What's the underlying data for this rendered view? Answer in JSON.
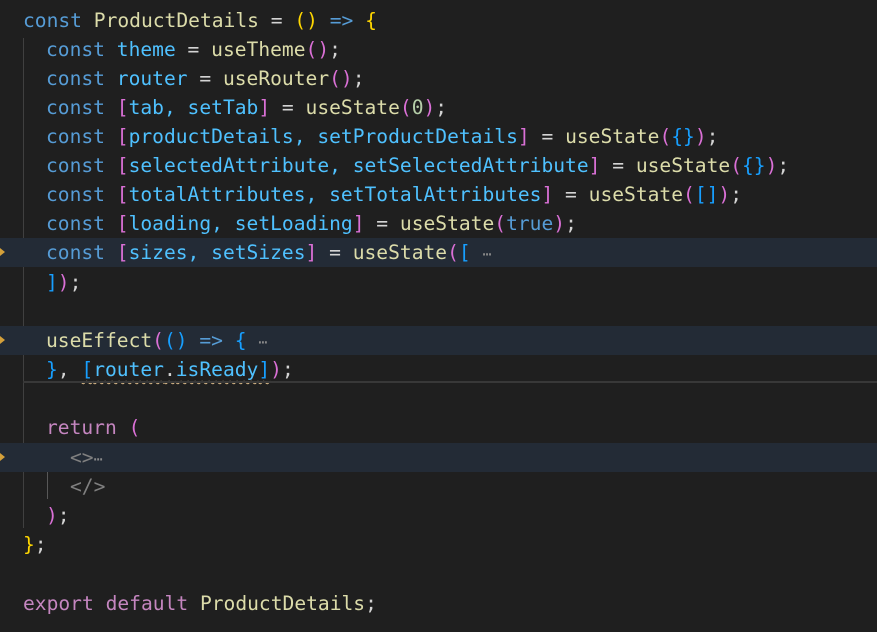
{
  "editor": {
    "theme_colors": {
      "background": "#1f1f1f",
      "keyword": "#569cd6",
      "variable": "#4fc1ff",
      "function": "#dcdcaa",
      "control": "#c586c0",
      "bracket_level1": "#ffd700",
      "bracket_level2": "#da70d6",
      "bracket_level3": "#179fff",
      "warning_squiggle": "#e2c08d"
    },
    "lines": [
      {
        "tokens": [
          "const",
          " ",
          "ProductDetails",
          " = ",
          "(",
          ")",
          " ",
          "=>",
          " ",
          "{"
        ]
      },
      {
        "tokens": [
          "const",
          " ",
          "theme",
          " = ",
          "useTheme",
          "(",
          ")",
          ";"
        ]
      },
      {
        "tokens": [
          "const",
          " ",
          "router",
          " = ",
          "useRouter",
          "(",
          ")",
          ";"
        ]
      },
      {
        "tokens": [
          "const",
          " ",
          "[",
          "tab, setTab",
          "]",
          " = ",
          "useState",
          "(",
          "0",
          ")",
          ";"
        ]
      },
      {
        "tokens": [
          "const",
          " ",
          "[",
          "productDetails, setProductDetails",
          "]",
          " = ",
          "useState",
          "(",
          "{}",
          ")",
          ";"
        ]
      },
      {
        "tokens": [
          "const",
          " ",
          "[",
          "selectedAttribute, setSelectedAttribute",
          "]",
          " = ",
          "useState",
          "(",
          "{}",
          ")",
          ";"
        ]
      },
      {
        "tokens": [
          "const",
          " ",
          "[",
          "totalAttributes, setTotalAttributes",
          "]",
          " = ",
          "useState",
          "(",
          "[]",
          ")",
          ";"
        ]
      },
      {
        "tokens": [
          "const",
          " ",
          "[",
          "loading, setLoading",
          "]",
          " = ",
          "useState",
          "(",
          "true",
          ")",
          ";"
        ]
      },
      {
        "tokens": [
          "const",
          " ",
          "[",
          "sizes, setSizes",
          "]",
          " = ",
          "useState",
          "(",
          "[",
          " ",
          "⋯"
        ]
      },
      {
        "tokens": [
          "]",
          ")",
          ";"
        ]
      },
      {
        "tokens": []
      },
      {
        "tokens": [
          "useEffect",
          "(",
          "(",
          ")",
          " ",
          "=>",
          " ",
          "{",
          " ",
          "⋯"
        ]
      },
      {
        "tokens": [
          "}",
          ", ",
          "[",
          "router",
          ".",
          "isReady",
          "]",
          ")",
          ";"
        ]
      },
      {
        "tokens": []
      },
      {
        "tokens": [
          "return",
          " ",
          "("
        ]
      },
      {
        "tokens": [
          "<>",
          "⋯"
        ]
      },
      {
        "tokens": [
          "</>"
        ]
      },
      {
        "tokens": [
          ")",
          ";"
        ]
      },
      {
        "tokens": [
          "}",
          ";"
        ]
      },
      {
        "tokens": []
      },
      {
        "tokens": [
          "export",
          " ",
          "default",
          " ",
          "ProductDetails",
          ";"
        ]
      }
    ]
  }
}
